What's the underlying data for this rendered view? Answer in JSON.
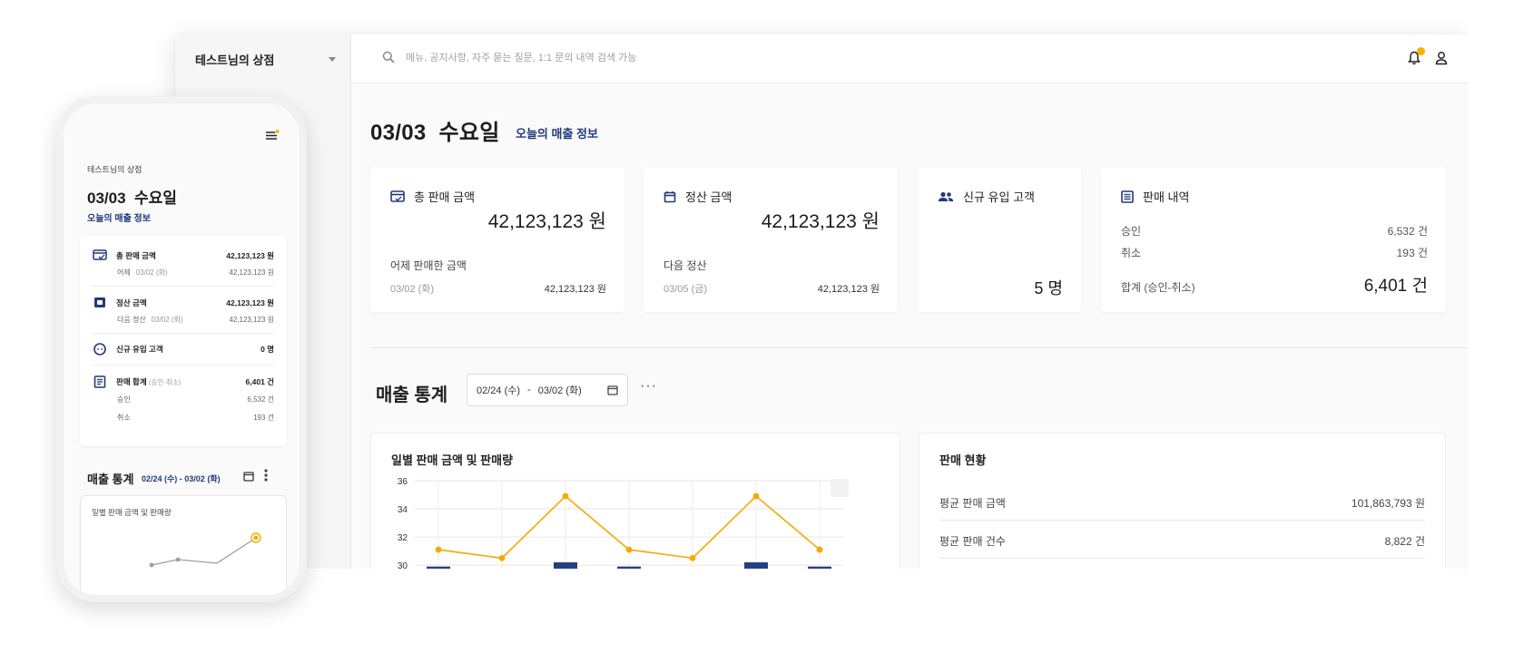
{
  "desktop": {
    "store_name": "테스트님의 상점",
    "search_placeholder": "메뉴, 공지사항, 자주 묻는 질문, 1:1 문의 내역 검색 가능",
    "date_title": "03/03  수요일",
    "today_link": "오늘의 매출 정보",
    "cards": {
      "total": {
        "title": "총 판매 금액",
        "amount": "42,123,123 원",
        "sub": "어제 판매한 금액",
        "date": "03/02 (화)",
        "value": "42,123,123 원"
      },
      "settle": {
        "title": "정산 금액",
        "amount": "42,123,123 원",
        "sub": "다음 정산",
        "date": "03/05 (금)",
        "value": "42,123,123 원"
      },
      "new_customers": {
        "title": "신규 유입 고객",
        "count": "5 명"
      },
      "sales": {
        "title": "판매 내역",
        "approved_label": "승인",
        "approved_value": "6,532 건",
        "cancel_label": "취소",
        "cancel_value": "193 건",
        "total_label": "합계 (승인-취소)",
        "total_value": "6,401 건"
      }
    },
    "stats": {
      "title": "매출 통계",
      "range_start": "02/24 (수)",
      "range_sep": "-",
      "range_end": "03/02 (화)",
      "more": "···"
    },
    "chart_panel": {
      "title": "일별 판매 금액 및 판매량"
    },
    "status_panel": {
      "title": "판매 현황",
      "rows": [
        {
          "label": "평균 판매 금액",
          "value": "101,863,793 원"
        },
        {
          "label": "평균 판매 건수",
          "value": "8,822 건"
        }
      ]
    }
  },
  "chart_data": {
    "type": "bar+line",
    "y_ticks": [
      "36",
      "34",
      "32",
      "30"
    ],
    "ylim": [
      29.3,
      36
    ],
    "categories": [
      "",
      "",
      "",
      "",
      "",
      "",
      ""
    ],
    "series": [
      {
        "kind": "line",
        "values": [
          31.1,
          30.5,
          34.9,
          31.1,
          30.5,
          34.9,
          31.1
        ],
        "color": "#f4a900"
      },
      {
        "kind": "bar",
        "values": [
          29.9,
          null,
          30.2,
          29.9,
          null,
          30.2,
          29.9
        ],
        "color": "#263f7e"
      }
    ]
  },
  "mobile": {
    "store_name": "테스트님의 상점",
    "date_title": "03/03  수요일",
    "today_link": "오늘의 매출 정보",
    "items": [
      {
        "name": "총 판매 금액",
        "value": "42,123,123 원",
        "sub_label": "어제",
        "sub_date": "03/02 (화)",
        "sub_value": "42,123,123 원"
      },
      {
        "name": "정산 금액",
        "value": "42,123,123 원",
        "sub_label": "다음 정산",
        "sub_date": "03/02 (화)",
        "sub_value": "42,123,123 원"
      },
      {
        "name": "신규 유입 고객",
        "value": "0 명"
      },
      {
        "name": "판매 합계",
        "name_note": "(승인-취소)",
        "value": "6,401 건",
        "approved_label": "승인",
        "approved_value": "6,532 건",
        "cancel_label": "취소",
        "cancel_value": "193 건"
      }
    ],
    "stats_title": "매출 통계",
    "stats_range": "02/24 (수) - 03/02 (화)",
    "chart_title": "일별 판매 금액 및 판매량"
  },
  "colors": {
    "accent": "#223a7a",
    "warning": "#f6b400",
    "bar": "#263f7e",
    "line": "#f4a900"
  }
}
